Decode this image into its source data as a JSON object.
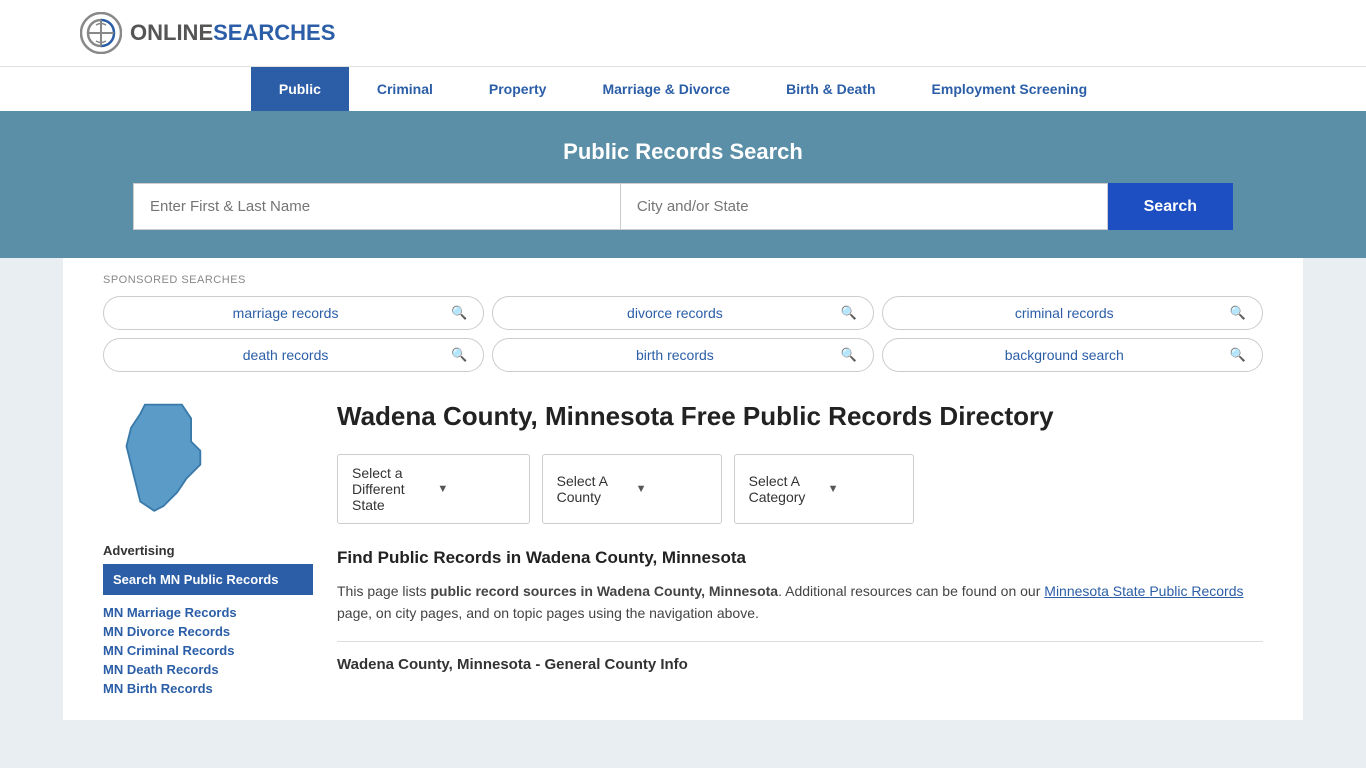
{
  "site": {
    "logo_online": "ONLINE",
    "logo_searches": "SEARCHES"
  },
  "nav": {
    "items": [
      {
        "label": "Public",
        "active": true
      },
      {
        "label": "Criminal",
        "active": false
      },
      {
        "label": "Property",
        "active": false
      },
      {
        "label": "Marriage & Divorce",
        "active": false
      },
      {
        "label": "Birth & Death",
        "active": false
      },
      {
        "label": "Employment Screening",
        "active": false
      }
    ]
  },
  "hero": {
    "title": "Public Records Search",
    "name_placeholder": "Enter First & Last Name",
    "location_placeholder": "City and/or State",
    "search_button": "Search"
  },
  "sponsored": {
    "label": "SPONSORED SEARCHES",
    "items": [
      {
        "label": "marriage records"
      },
      {
        "label": "divorce records"
      },
      {
        "label": "criminal records"
      },
      {
        "label": "death records"
      },
      {
        "label": "birth records"
      },
      {
        "label": "background search"
      }
    ]
  },
  "page": {
    "title": "Wadena County, Minnesota Free Public Records Directory",
    "dropdowns": {
      "state": "Select a Different State",
      "county": "Select A County",
      "category": "Select A Category"
    },
    "find_heading": "Find Public Records in Wadena County, Minnesota",
    "description": "This page lists ",
    "description_bold": "public record sources in Wadena County, Minnesota",
    "description_end": ". Additional resources can be found on our",
    "link_text": "Minnesota State Public Records",
    "description_tail": " page, on city pages, and on topic pages using the navigation above.",
    "county_info_heading": "Wadena County, Minnesota - General County Info"
  },
  "sidebar": {
    "ad_label": "Advertising",
    "ad_box_text": "Search MN Public Records",
    "links": [
      {
        "label": "MN Marriage Records"
      },
      {
        "label": "MN Divorce Records"
      },
      {
        "label": "MN Criminal Records"
      },
      {
        "label": "MN Death Records"
      },
      {
        "label": "MN Birth Records"
      }
    ]
  }
}
